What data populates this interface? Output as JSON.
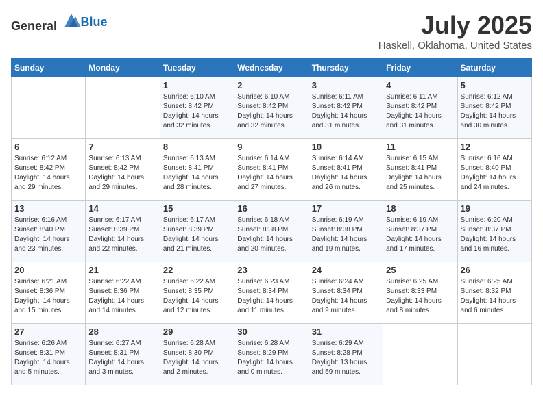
{
  "header": {
    "logo_general": "General",
    "logo_blue": "Blue",
    "title": "July 2025",
    "subtitle": "Haskell, Oklahoma, United States"
  },
  "weekdays": [
    "Sunday",
    "Monday",
    "Tuesday",
    "Wednesday",
    "Thursday",
    "Friday",
    "Saturday"
  ],
  "weeks": [
    [
      {
        "day": "",
        "empty": true
      },
      {
        "day": "",
        "empty": true
      },
      {
        "day": "1",
        "sunrise": "Sunrise: 6:10 AM",
        "sunset": "Sunset: 8:42 PM",
        "daylight": "Daylight: 14 hours and 32 minutes."
      },
      {
        "day": "2",
        "sunrise": "Sunrise: 6:10 AM",
        "sunset": "Sunset: 8:42 PM",
        "daylight": "Daylight: 14 hours and 32 minutes."
      },
      {
        "day": "3",
        "sunrise": "Sunrise: 6:11 AM",
        "sunset": "Sunset: 8:42 PM",
        "daylight": "Daylight: 14 hours and 31 minutes."
      },
      {
        "day": "4",
        "sunrise": "Sunrise: 6:11 AM",
        "sunset": "Sunset: 8:42 PM",
        "daylight": "Daylight: 14 hours and 31 minutes."
      },
      {
        "day": "5",
        "sunrise": "Sunrise: 6:12 AM",
        "sunset": "Sunset: 8:42 PM",
        "daylight": "Daylight: 14 hours and 30 minutes."
      }
    ],
    [
      {
        "day": "6",
        "sunrise": "Sunrise: 6:12 AM",
        "sunset": "Sunset: 8:42 PM",
        "daylight": "Daylight: 14 hours and 29 minutes."
      },
      {
        "day": "7",
        "sunrise": "Sunrise: 6:13 AM",
        "sunset": "Sunset: 8:42 PM",
        "daylight": "Daylight: 14 hours and 29 minutes."
      },
      {
        "day": "8",
        "sunrise": "Sunrise: 6:13 AM",
        "sunset": "Sunset: 8:41 PM",
        "daylight": "Daylight: 14 hours and 28 minutes."
      },
      {
        "day": "9",
        "sunrise": "Sunrise: 6:14 AM",
        "sunset": "Sunset: 8:41 PM",
        "daylight": "Daylight: 14 hours and 27 minutes."
      },
      {
        "day": "10",
        "sunrise": "Sunrise: 6:14 AM",
        "sunset": "Sunset: 8:41 PM",
        "daylight": "Daylight: 14 hours and 26 minutes."
      },
      {
        "day": "11",
        "sunrise": "Sunrise: 6:15 AM",
        "sunset": "Sunset: 8:41 PM",
        "daylight": "Daylight: 14 hours and 25 minutes."
      },
      {
        "day": "12",
        "sunrise": "Sunrise: 6:16 AM",
        "sunset": "Sunset: 8:40 PM",
        "daylight": "Daylight: 14 hours and 24 minutes."
      }
    ],
    [
      {
        "day": "13",
        "sunrise": "Sunrise: 6:16 AM",
        "sunset": "Sunset: 8:40 PM",
        "daylight": "Daylight: 14 hours and 23 minutes."
      },
      {
        "day": "14",
        "sunrise": "Sunrise: 6:17 AM",
        "sunset": "Sunset: 8:39 PM",
        "daylight": "Daylight: 14 hours and 22 minutes."
      },
      {
        "day": "15",
        "sunrise": "Sunrise: 6:17 AM",
        "sunset": "Sunset: 8:39 PM",
        "daylight": "Daylight: 14 hours and 21 minutes."
      },
      {
        "day": "16",
        "sunrise": "Sunrise: 6:18 AM",
        "sunset": "Sunset: 8:38 PM",
        "daylight": "Daylight: 14 hours and 20 minutes."
      },
      {
        "day": "17",
        "sunrise": "Sunrise: 6:19 AM",
        "sunset": "Sunset: 8:38 PM",
        "daylight": "Daylight: 14 hours and 19 minutes."
      },
      {
        "day": "18",
        "sunrise": "Sunrise: 6:19 AM",
        "sunset": "Sunset: 8:37 PM",
        "daylight": "Daylight: 14 hours and 17 minutes."
      },
      {
        "day": "19",
        "sunrise": "Sunrise: 6:20 AM",
        "sunset": "Sunset: 8:37 PM",
        "daylight": "Daylight: 14 hours and 16 minutes."
      }
    ],
    [
      {
        "day": "20",
        "sunrise": "Sunrise: 6:21 AM",
        "sunset": "Sunset: 8:36 PM",
        "daylight": "Daylight: 14 hours and 15 minutes."
      },
      {
        "day": "21",
        "sunrise": "Sunrise: 6:22 AM",
        "sunset": "Sunset: 8:36 PM",
        "daylight": "Daylight: 14 hours and 14 minutes."
      },
      {
        "day": "22",
        "sunrise": "Sunrise: 6:22 AM",
        "sunset": "Sunset: 8:35 PM",
        "daylight": "Daylight: 14 hours and 12 minutes."
      },
      {
        "day": "23",
        "sunrise": "Sunrise: 6:23 AM",
        "sunset": "Sunset: 8:34 PM",
        "daylight": "Daylight: 14 hours and 11 minutes."
      },
      {
        "day": "24",
        "sunrise": "Sunrise: 6:24 AM",
        "sunset": "Sunset: 8:34 PM",
        "daylight": "Daylight: 14 hours and 9 minutes."
      },
      {
        "day": "25",
        "sunrise": "Sunrise: 6:25 AM",
        "sunset": "Sunset: 8:33 PM",
        "daylight": "Daylight: 14 hours and 8 minutes."
      },
      {
        "day": "26",
        "sunrise": "Sunrise: 6:25 AM",
        "sunset": "Sunset: 8:32 PM",
        "daylight": "Daylight: 14 hours and 6 minutes."
      }
    ],
    [
      {
        "day": "27",
        "sunrise": "Sunrise: 6:26 AM",
        "sunset": "Sunset: 8:31 PM",
        "daylight": "Daylight: 14 hours and 5 minutes."
      },
      {
        "day": "28",
        "sunrise": "Sunrise: 6:27 AM",
        "sunset": "Sunset: 8:31 PM",
        "daylight": "Daylight: 14 hours and 3 minutes."
      },
      {
        "day": "29",
        "sunrise": "Sunrise: 6:28 AM",
        "sunset": "Sunset: 8:30 PM",
        "daylight": "Daylight: 14 hours and 2 minutes."
      },
      {
        "day": "30",
        "sunrise": "Sunrise: 6:28 AM",
        "sunset": "Sunset: 8:29 PM",
        "daylight": "Daylight: 14 hours and 0 minutes."
      },
      {
        "day": "31",
        "sunrise": "Sunrise: 6:29 AM",
        "sunset": "Sunset: 8:28 PM",
        "daylight": "Daylight: 13 hours and 59 minutes."
      },
      {
        "day": "",
        "empty": true
      },
      {
        "day": "",
        "empty": true
      }
    ]
  ]
}
